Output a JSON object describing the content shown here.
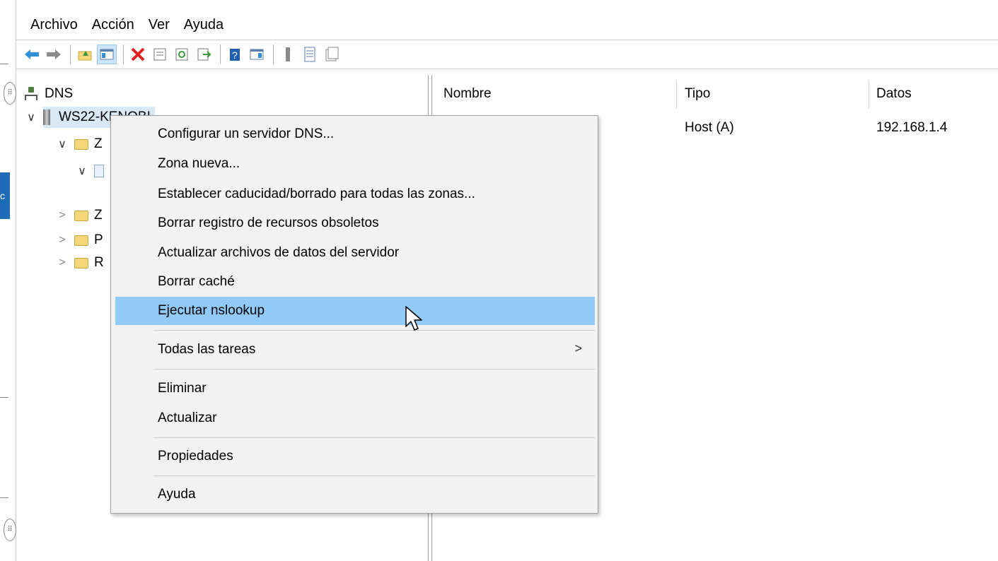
{
  "menu": {
    "items": [
      "Archivo",
      "Acción",
      "Ver",
      "Ayuda"
    ]
  },
  "toolbar": {
    "icons": [
      "back-arrow-icon",
      "forward-arrow-icon",
      "up-folder-icon",
      "show-hide-tree-icon",
      "delete-icon",
      "properties-icon",
      "refresh-icon",
      "export-list-icon",
      "help-icon",
      "show-hide-action-pane-icon",
      "server-icon",
      "list-icon",
      "console-icon"
    ]
  },
  "tree": {
    "root_label": "DNS",
    "server_label": "WS22-KENOBI",
    "child1_label": "Z",
    "child4_label": "Z",
    "child5_label": "P",
    "child6_label": "R"
  },
  "list": {
    "columns": [
      "Nombre",
      "Tipo",
      "Datos"
    ],
    "rows": [
      {
        "name": "",
        "type": "Host (A)",
        "data": "192.168.1.4"
      }
    ]
  },
  "context_menu": {
    "items": [
      "Configurar un servidor DNS...",
      "Zona nueva...",
      "Establecer caducidad/borrado para todas las zonas...",
      "Borrar registro de recursos obsoletos",
      "Actualizar archivos de datos del servidor",
      "Borrar caché",
      "Ejecutar nslookup",
      "Todas las tareas",
      "Eliminar",
      "Actualizar",
      "Propiedades",
      "Ayuda"
    ],
    "highlighted": "Ejecutar nslookup",
    "submenu_arrow": ">"
  },
  "colors": {
    "highlight": "#91c9f7",
    "menu_bg": "#f2f2f2",
    "selected_tree": "#d9e8f5"
  }
}
